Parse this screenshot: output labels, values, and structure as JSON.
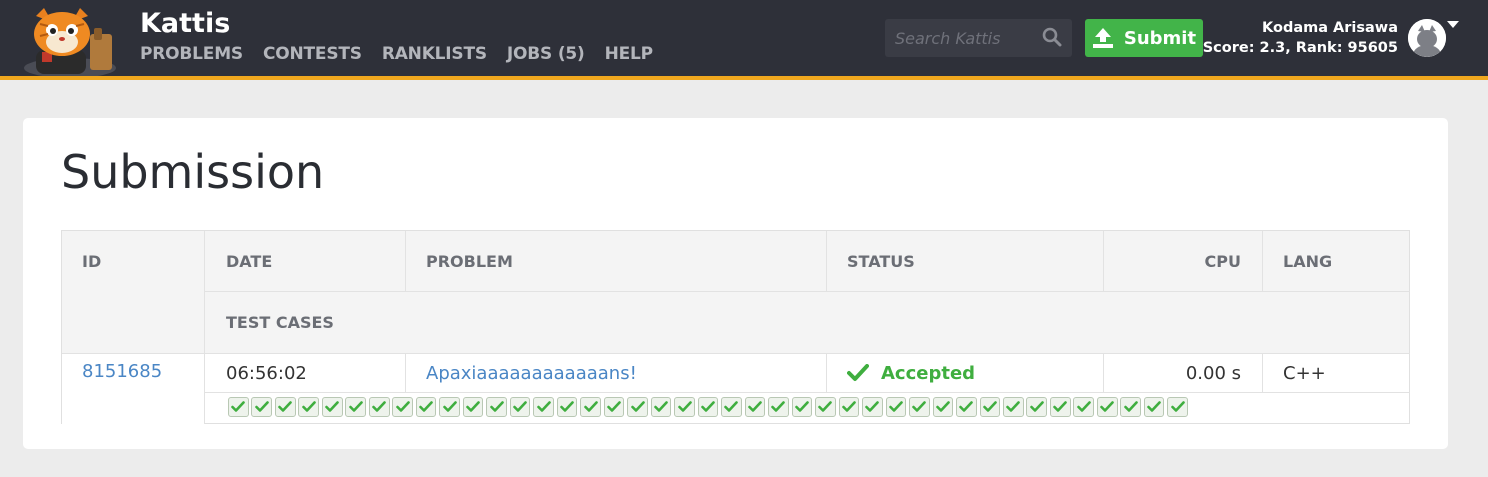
{
  "header": {
    "brand": "Kattis",
    "nav": [
      "PROBLEMS",
      "CONTESTS",
      "RANKLISTS",
      "JOBS (5)",
      "HELP"
    ],
    "search_placeholder": "Search Kattis",
    "submit_label": "Submit",
    "user_name": "Kodama Arisawa",
    "user_stats": "Score: 2.3, Rank: 95605"
  },
  "page": {
    "title": "Submission"
  },
  "table": {
    "headers": {
      "id": "ID",
      "date": "DATE",
      "problem": "PROBLEM",
      "status": "STATUS",
      "cpu": "CPU",
      "lang": "LANG",
      "test_cases": "TEST CASES"
    },
    "row": {
      "id": "8151685",
      "date": "06:56:02",
      "problem": "Apaxiaaaaaaaaaaaans!",
      "status": "Accepted",
      "cpu": "0.00 s",
      "lang": "C++"
    },
    "test_case_count": 41,
    "test_case_status": "accepted"
  },
  "colors": {
    "topbar": "#2e3039",
    "accent": "#f0a71e",
    "submit_green": "#42b449",
    "link_blue": "#4a86c5",
    "accepted_green": "#3fae3f"
  }
}
